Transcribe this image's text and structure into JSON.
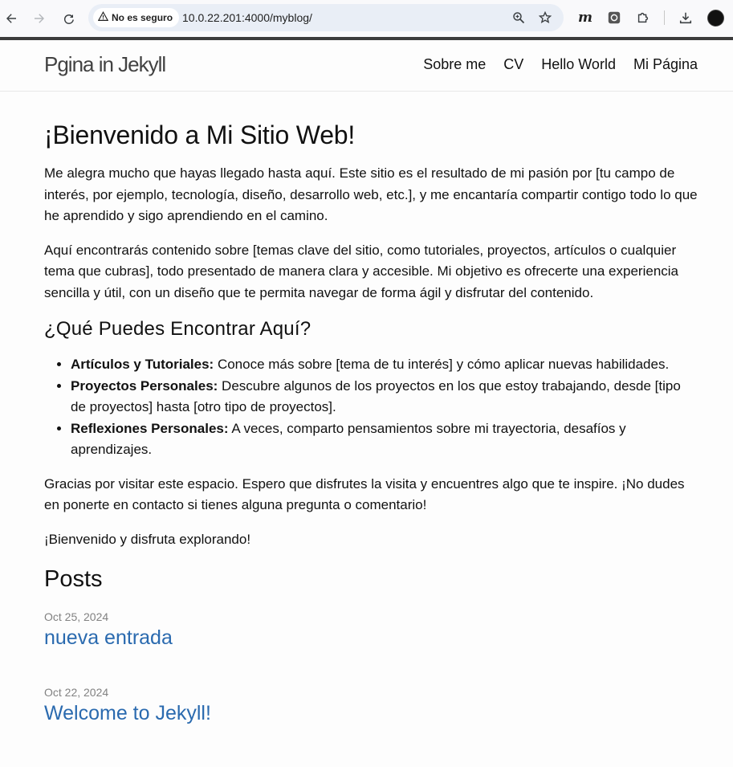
{
  "browser": {
    "security_label": "No es seguro",
    "url": "10.0.22.201:4000/myblog/",
    "icons": [
      "back-icon",
      "forward-icon",
      "reload-icon",
      "warning-icon",
      "zoom-icon",
      "star-icon",
      "extension-m-icon",
      "extension-square-icon",
      "puzzle-icon",
      "download-icon"
    ]
  },
  "site": {
    "title": "Pgina in Jekyll",
    "nav": [
      "Sobre me",
      "CV",
      "Hello World",
      "Mi Página"
    ]
  },
  "page": {
    "heading": "¡Bienvenido a Mi Sitio Web!",
    "intro_1": "Me alegra mucho que hayas llegado hasta aquí. Este sitio es el resultado de mi pasión por [tu campo de interés, por ejemplo, tecnología, diseño, desarrollo web, etc.], y me encantaría compartir contigo todo lo que he aprendido y sigo aprendiendo en el camino.",
    "intro_2": "Aquí encontrarás contenido sobre [temas clave del sitio, como tutoriales, proyectos, artículos o cualquier tema que cubras], todo presentado de manera clara y accesible. Mi objetivo es ofrecerte una experiencia sencilla y útil, con un diseño que te permita navegar de forma ágil y disfrutar del contenido.",
    "section_heading": "¿Qué Puedes Encontrar Aquí?",
    "features": [
      {
        "title": "Artículos y Tutoriales:",
        "text": " Conoce más sobre [tema de tu interés] y cómo aplicar nuevas habilidades."
      },
      {
        "title": "Proyectos Personales:",
        "text": " Descubre algunos de los proyectos en los que estoy trabajando, desde [tipo de proyectos] hasta [otro tipo de proyectos]."
      },
      {
        "title": "Reflexiones Personales:",
        "text": " A veces, comparto pensamientos sobre mi trayectoria, desafíos y aprendizajes."
      }
    ],
    "closing_1": "Gracias por visitar este espacio. Espero que disfrutes la visita y encuentres algo que te inspire. ¡No dudes en ponerte en contacto si tienes alguna pregunta o comentario!",
    "closing_2": "¡Bienvenido y disfruta explorando!",
    "posts_heading": "Posts",
    "posts": [
      {
        "date": "Oct 25, 2024",
        "title": "nueva entrada"
      },
      {
        "date": "Oct 22, 2024",
        "title": "Welcome to Jekyll!"
      }
    ]
  }
}
